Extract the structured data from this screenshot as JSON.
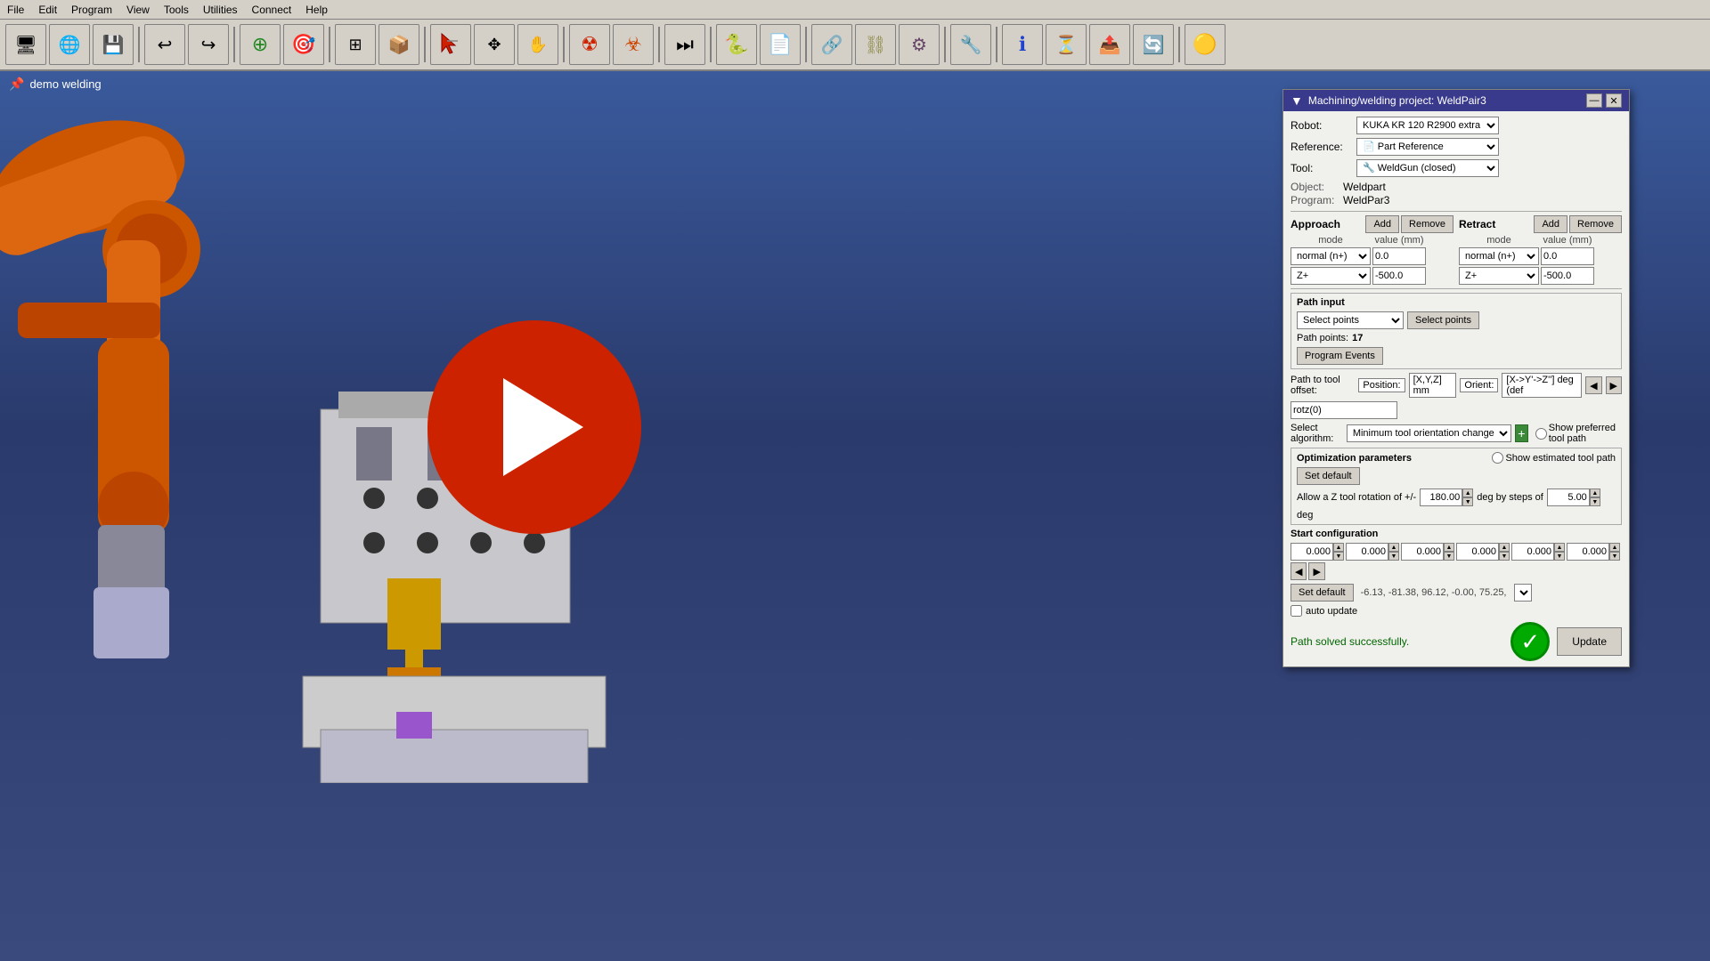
{
  "menubar": {
    "items": [
      "File",
      "Edit",
      "Program",
      "View",
      "Tools",
      "Utilities",
      "Connect",
      "Help"
    ]
  },
  "toolbar": {
    "buttons": [
      {
        "name": "monitor-icon",
        "glyph": "🖥"
      },
      {
        "name": "globe-icon",
        "glyph": "🌐"
      },
      {
        "name": "save-icon",
        "glyph": "💾"
      },
      {
        "name": "undo-icon",
        "glyph": "↩"
      },
      {
        "name": "redo-icon",
        "glyph": "↪"
      },
      {
        "name": "add-path-icon",
        "glyph": "➕"
      },
      {
        "name": "target-icon",
        "glyph": "🎯"
      },
      {
        "name": "fit-icon",
        "glyph": "⊞"
      },
      {
        "name": "box-icon",
        "glyph": "📦"
      },
      {
        "name": "select-icon",
        "glyph": "↖"
      },
      {
        "name": "move-icon",
        "glyph": "✥"
      },
      {
        "name": "pan-icon",
        "glyph": "✋"
      },
      {
        "name": "radiation-icon",
        "glyph": "☢"
      },
      {
        "name": "radiation2-icon",
        "glyph": "☣"
      },
      {
        "name": "skip-icon",
        "glyph": "⏭"
      },
      {
        "name": "python-icon",
        "glyph": "🐍"
      },
      {
        "name": "doc-icon",
        "glyph": "📄"
      },
      {
        "name": "link-icon",
        "glyph": "🔗"
      },
      {
        "name": "chain-icon",
        "glyph": "⛓"
      },
      {
        "name": "gear3-icon",
        "glyph": "⚙"
      },
      {
        "name": "tool-icon",
        "glyph": "🔧"
      },
      {
        "name": "info-icon",
        "glyph": "ℹ"
      },
      {
        "name": "timer-icon",
        "glyph": "⏳"
      },
      {
        "name": "export-icon",
        "glyph": "📤"
      },
      {
        "name": "refresh-icon",
        "glyph": "🔄"
      },
      {
        "name": "cube-icon",
        "glyph": "🟡"
      }
    ]
  },
  "viewport": {
    "project_label": "demo welding"
  },
  "panel": {
    "title": "Machining/welding project: WeldPair3",
    "robot_label": "Robot:",
    "robot_value": "KUKA KR 120 R2900 extra",
    "reference_label": "Reference:",
    "reference_value": "Part Reference",
    "tool_label": "Tool:",
    "tool_value": "WeldGun (closed)",
    "object_label": "Object:",
    "object_value": "Weldpart",
    "program_label": "Program:",
    "program_value": "WeldPar3",
    "approach": {
      "title": "Approach",
      "add_label": "Add",
      "remove_label": "Remove",
      "mode_header": "mode",
      "value_header": "value (mm)",
      "rows": [
        {
          "mode": "normal (n+)",
          "value": "0.0"
        },
        {
          "mode": "Z+",
          "value": "-500.0"
        }
      ]
    },
    "retract": {
      "title": "Retract",
      "add_label": "Add",
      "remove_label": "Remove",
      "mode_header": "mode",
      "value_header": "value (mm)",
      "rows": [
        {
          "mode": "normal (n+)",
          "value": "0.0"
        },
        {
          "mode": "Z+",
          "value": "-500.0"
        }
      ]
    },
    "path_input": {
      "title": "Path input",
      "btn1": "Select points",
      "btn2": "Select points",
      "path_points_label": "Path points:",
      "path_points_value": "17",
      "program_events_btn": "Program Events"
    },
    "path_to_tool_offset": {
      "label": "Path to tool offset:",
      "position_label": "Position:",
      "position_value": "[X,Y,Z]  mm",
      "orient_label": "Orient:",
      "orient_value": "[X->Y'->Z'']  deg (def",
      "orient_btn1": "◀",
      "orient_btn2": "▶",
      "formula": "rotz(0)"
    },
    "select_algorithm": {
      "label": "Select algorithm:",
      "value": "Minimum tool orientation change",
      "show_preferred": "Show preferred tool path",
      "show_estimated": "Show estimated tool path"
    },
    "optimization": {
      "title": "Optimization parameters",
      "set_default_btn": "Set default",
      "allow_z_label": "Allow a Z tool rotation of +/-",
      "z_value": "180.00",
      "deg_by_label": "deg by steps of",
      "steps_value": "5.00",
      "deg_label": "deg"
    },
    "start_config": {
      "title": "Start configuration",
      "values": [
        "0.000",
        "0.000",
        "0.000",
        "0.000",
        "0.000",
        "0.000"
      ],
      "set_default_btn": "Set default",
      "current_config": "-6.13,    -81.38,    96.12,    -0.00,    75.25,"
    },
    "auto_update": {
      "label": "auto update"
    },
    "status": {
      "text": "Path solved successfully.",
      "update_btn": "Update"
    }
  }
}
